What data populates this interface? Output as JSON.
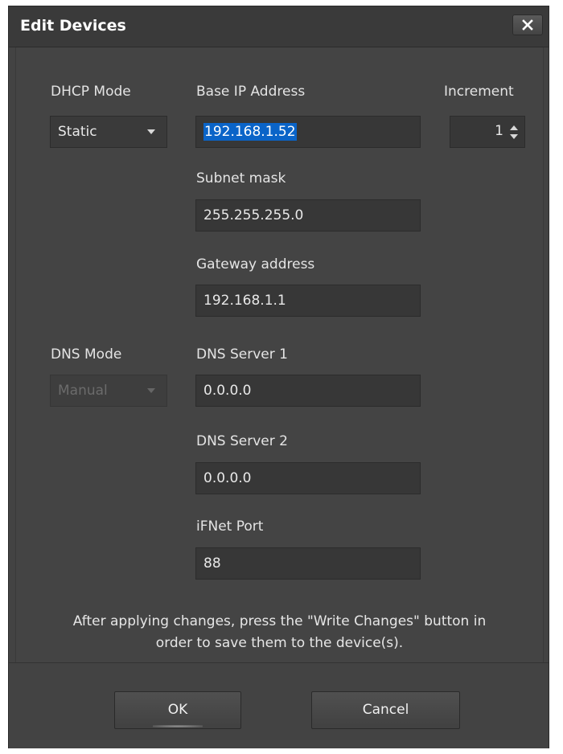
{
  "dialog": {
    "title": "Edit Devices",
    "close_symbol": "✕"
  },
  "dhcp": {
    "label": "DHCP Mode",
    "value": "Static"
  },
  "base_ip": {
    "label": "Base IP Address",
    "value": "192.168.1.52"
  },
  "increment": {
    "label": "Increment",
    "value": "1"
  },
  "subnet": {
    "label": "Subnet mask",
    "value": "255.255.255.0"
  },
  "gateway": {
    "label": "Gateway address",
    "value": "192.168.1.1"
  },
  "dns_mode": {
    "label": "DNS Mode",
    "value": "Manual"
  },
  "dns1": {
    "label": "DNS Server 1",
    "value": "0.0.0.0"
  },
  "dns2": {
    "label": "DNS Server 2",
    "value": "0.0.0.0"
  },
  "ifnet": {
    "label": "iFNet Port",
    "value": "88"
  },
  "note": {
    "line1": "After applying changes, press the \"Write Changes\" button in",
    "line2": "order to save them to the device(s)."
  },
  "buttons": {
    "ok": "OK",
    "cancel": "Cancel"
  },
  "colors": {
    "background": "#434343",
    "selection": "#0a64c8",
    "text": "#e6e6e6"
  }
}
